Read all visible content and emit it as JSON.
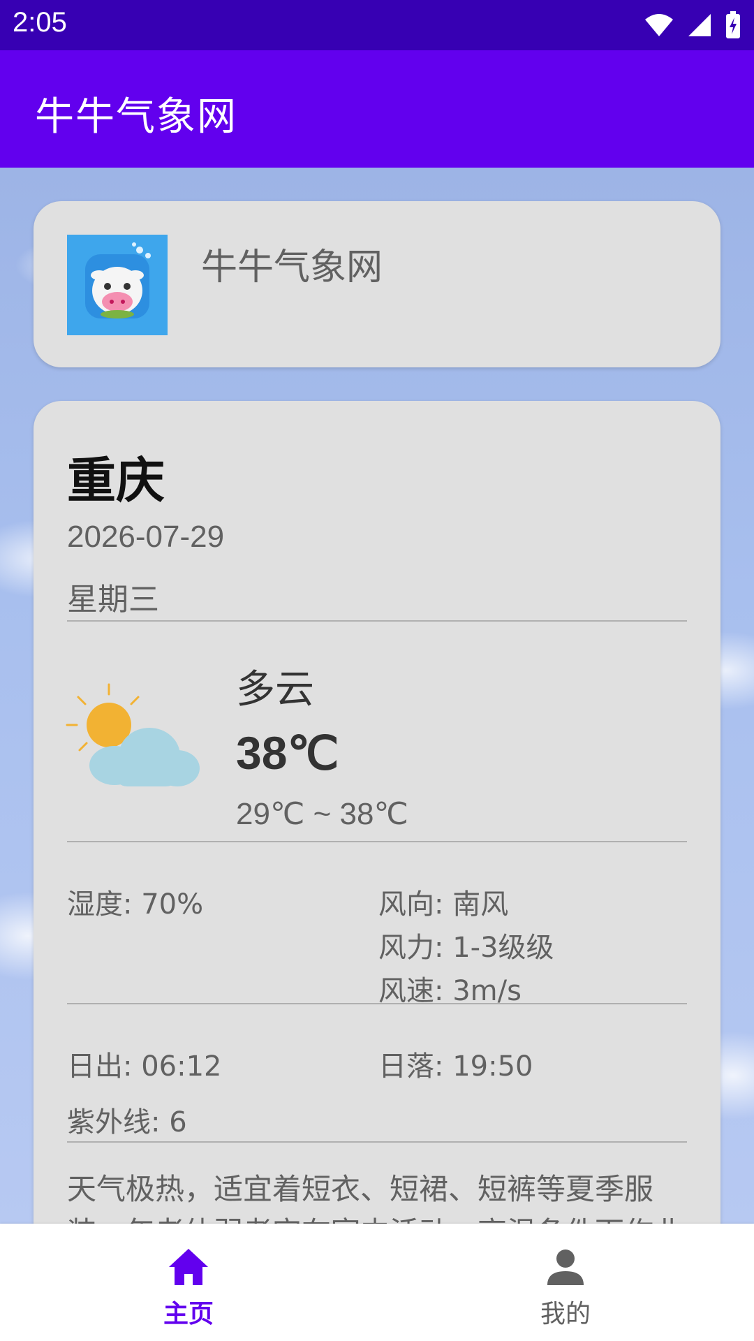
{
  "status_bar": {
    "time": "2:05"
  },
  "app_bar": {
    "title": "牛牛气象网"
  },
  "header_card": {
    "app_name": "牛牛气象网"
  },
  "weather": {
    "city": "重庆",
    "date": "2026-07-29",
    "weekday": "星期三",
    "condition": "多云",
    "temperature": "38℃",
    "temp_range": "29℃ ~ 38℃",
    "humidity": "湿度: 70%",
    "wind_direction": "风向: 南风",
    "wind_force": "风力: 1-3级级",
    "wind_speed": "风速: 3m/s",
    "sunrise": "日出: 06:12",
    "sunset": "日落: 19:50",
    "uv": "紫外线: 6",
    "advice": "天气极热，适宜着短衣、短裙、短裤等夏季服装，年老体弱者宜在室内活动，高温条件下作业和"
  },
  "bottom_nav": {
    "home_label": "主页",
    "mine_label": "我的"
  },
  "colors": {
    "primary": "#6200ee",
    "primary_dark": "#3700b3",
    "card": "#e0e0e0"
  }
}
